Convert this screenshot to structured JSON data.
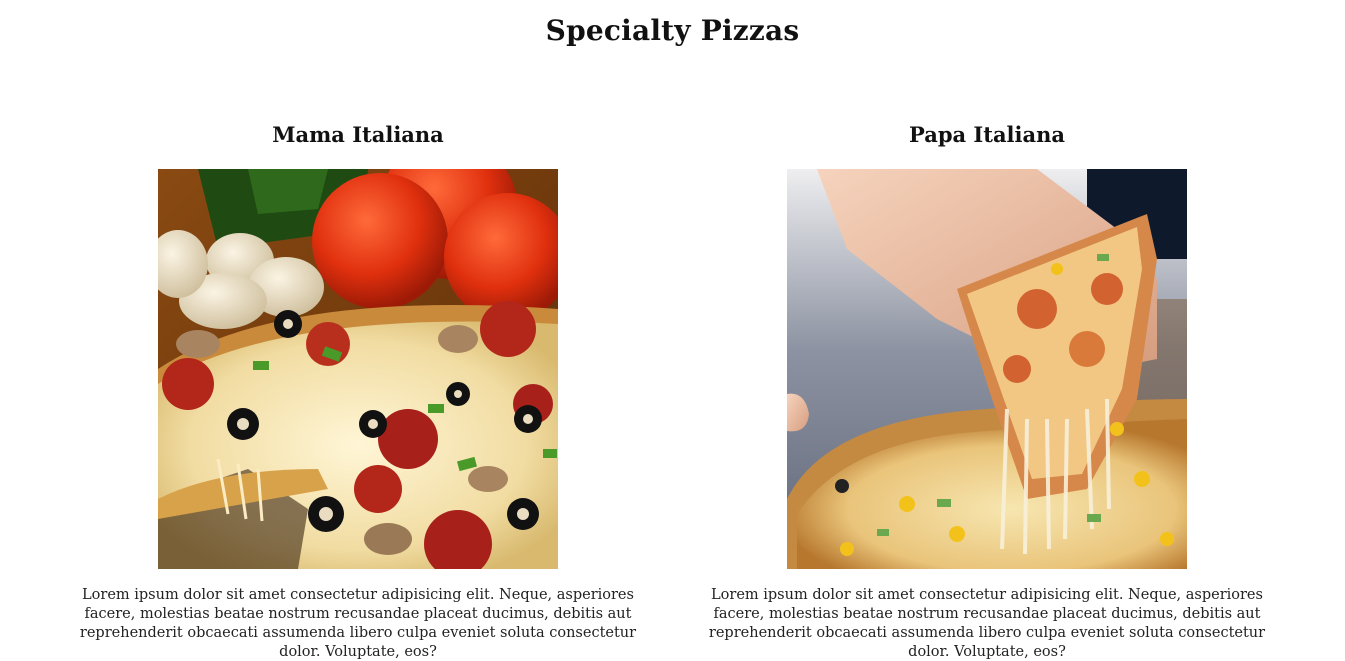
{
  "page": {
    "title": "Specialty Pizzas"
  },
  "pizzas": [
    {
      "name": "Mama Italiana",
      "description": "Lorem ipsum dolor sit amet consectetur adipisicing elit. Neque, asperiores facere, molestias beatae nostrum recusandae placeat ducimus, debitis aut reprehenderit obcaecati assumenda libero culpa eveniet soluta consectetur dolor. Voluptate, eos?"
    },
    {
      "name": "Papa Italiana",
      "description": "Lorem ipsum dolor sit amet consectetur adipisicing elit. Neque, asperiores facere, molestias beatae nostrum recusandae placeat ducimus, debitis aut reprehenderit obcaecati assumenda libero culpa eveniet soluta consectetur dolor. Voluptate, eos?"
    }
  ]
}
